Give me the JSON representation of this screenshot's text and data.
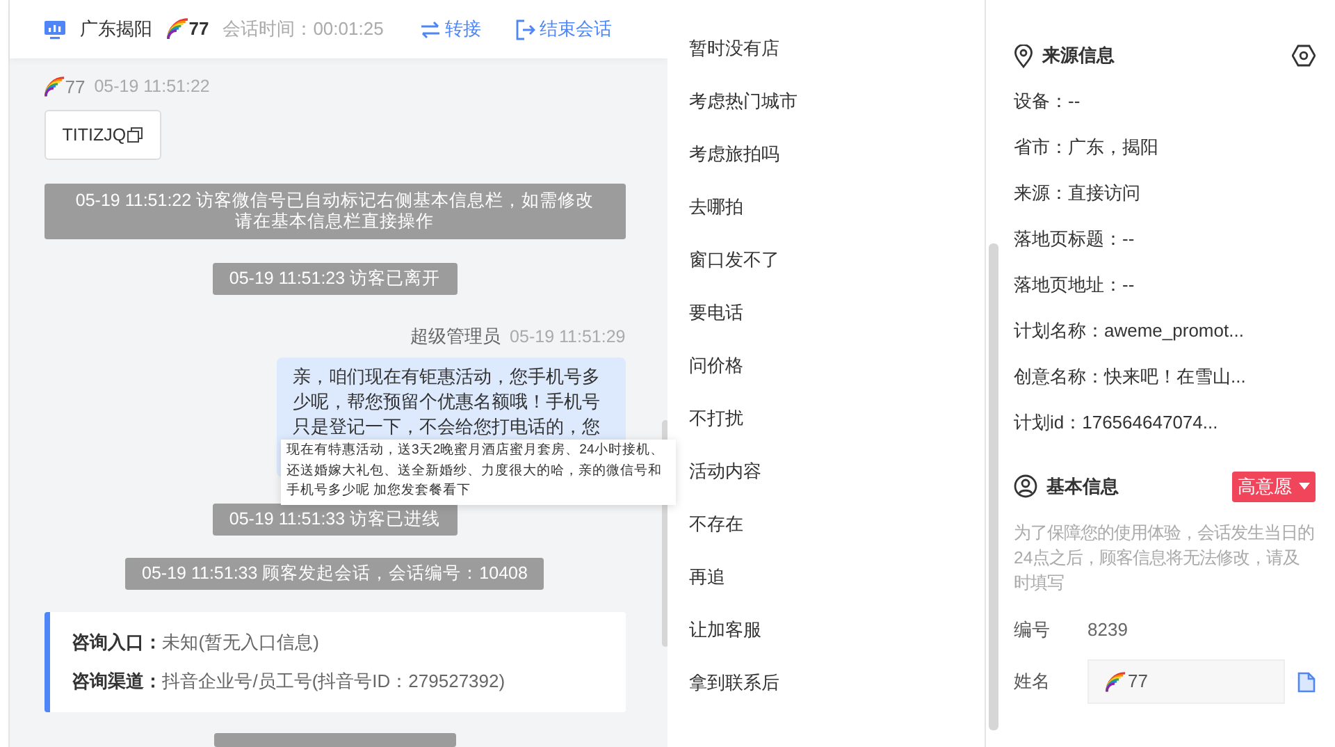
{
  "header": {
    "location": "广东揭阳",
    "visitor": "77",
    "duration_label": "会话时间：",
    "duration": "00:01:25",
    "actions": [
      {
        "kind": "transfer",
        "label": "转接"
      },
      {
        "kind": "end",
        "label": "结束会话"
      }
    ]
  },
  "messages": [
    {
      "kind": "visitor",
      "sender": "77",
      "time": "05-19 11:51:22",
      "text": "TITIZJQ"
    },
    {
      "kind": "system",
      "text": "05-19 11:51:22 访客微信号已自动标记右侧基本信息栏，如需修改请在基本信息栏直接操作"
    },
    {
      "kind": "system",
      "text": "05-19 11:51:23 访客已离开"
    },
    {
      "kind": "agent",
      "sender": "超级管理员",
      "time": "05-19 11:51:29",
      "text": "亲，咱们现在有钜惠活动，您手机号多少呢，帮您预留个优惠名额哦！手机号只是登记一下，不会给您打电话的，您"
    },
    {
      "kind": "system",
      "text": "05-19 11:51:33 访客已进线"
    },
    {
      "kind": "system",
      "text": "05-19 11:51:33 顾客发起会话，会话编号：10408"
    },
    {
      "kind": "consult",
      "fields": [
        {
          "label": "咨询入口：",
          "value": "未知(暂无入口信息)"
        },
        {
          "label": "咨询渠道：",
          "value": "抖音企业号/员工号(抖音号ID：279527392)"
        }
      ]
    }
  ],
  "tooltip": {
    "text": "现在有特惠活动，送3天2晚蜜月酒店蜜月套房、24小时接机、还送婚嫁大礼包、送全新婚纱、力度很大的哈，亲的微信号和手机号多少呢 加您发套餐看下"
  },
  "quick_replies": [
    "暂时没有店",
    "考虑热门城市",
    "考虑旅拍吗",
    "去哪拍",
    "窗口发不了",
    "要电话",
    "问价格",
    "不打扰",
    "活动内容",
    "不存在",
    "再追",
    "让加客服",
    "拿到联系后"
  ],
  "source_info": {
    "title": "来源信息",
    "rows": [
      "设备：--",
      "省市：广东，揭阳",
      "来源：直接访问",
      "落地页标题：--",
      "落地页地址：--",
      "计划名称：aweme_promot...",
      "创意名称：快来吧！在雪山...",
      "计划id：176564647074..."
    ]
  },
  "basic_info": {
    "title": "基本信息",
    "intent": "高意愿",
    "notice": "为了保障您的使用体验，会话发生当日的24点之后，顾客信息将无法修改，请及时填写",
    "fields": [
      {
        "kind": "text",
        "label": "编号",
        "value": "8239"
      },
      {
        "kind": "input",
        "label": "姓名",
        "value": "77"
      }
    ]
  }
}
